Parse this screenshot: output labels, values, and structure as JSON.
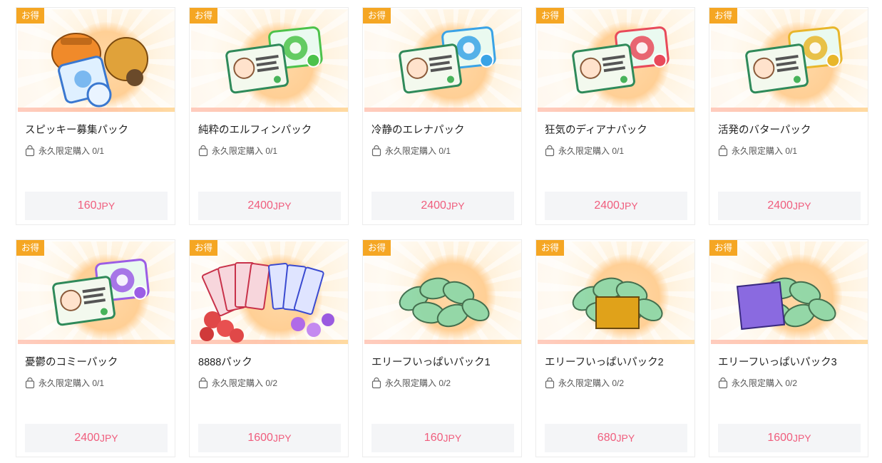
{
  "colors": {
    "badge": "#f5a623",
    "price": "#f05d7d",
    "price_bg": "#f4f5f7"
  },
  "icons": {
    "limit_icon": "shopping-bag-icon"
  },
  "products": [
    {
      "badge": "お得",
      "title": "スピッキー募集パック",
      "limit_label": "永久限定購入",
      "limit_count": "0/1",
      "price": "160",
      "currency": "JPY",
      "art": "bags"
    },
    {
      "badge": "お得",
      "title": "純粋のエルフィンパック",
      "limit_label": "永久限定購入",
      "limit_count": "0/1",
      "price": "2400",
      "currency": "JPY",
      "art": "tickets",
      "accent": "#4cc24a"
    },
    {
      "badge": "お得",
      "title": "冷静のエレナパック",
      "limit_label": "永久限定購入",
      "limit_count": "0/1",
      "price": "2400",
      "currency": "JPY",
      "art": "tickets",
      "accent": "#3aa3e6"
    },
    {
      "badge": "お得",
      "title": "狂気のディアナパック",
      "limit_label": "永久限定購入",
      "limit_count": "0/1",
      "price": "2400",
      "currency": "JPY",
      "art": "tickets",
      "accent": "#e84a5a"
    },
    {
      "badge": "お得",
      "title": "活発のバターパック",
      "limit_label": "永久限定購入",
      "limit_count": "0/1",
      "price": "2400",
      "currency": "JPY",
      "art": "tickets",
      "accent": "#e8b62a"
    },
    {
      "badge": "お得",
      "title": "憂鬱のコミーパック",
      "limit_label": "永久限定購入",
      "limit_count": "0/1",
      "price": "2400",
      "currency": "JPY",
      "art": "tickets",
      "accent": "#9b5de5"
    },
    {
      "badge": "お得",
      "title": "8888パック",
      "limit_label": "永久限定購入",
      "limit_count": "0/2",
      "price": "1600",
      "currency": "JPY",
      "art": "cards"
    },
    {
      "badge": "お得",
      "title": "エリーフいっぱいパック1",
      "limit_label": "永久限定購入",
      "limit_count": "0/2",
      "price": "160",
      "currency": "JPY",
      "art": "leaves"
    },
    {
      "badge": "お得",
      "title": "エリーフいっぱいパック2",
      "limit_label": "永久限定購入",
      "limit_count": "0/2",
      "price": "680",
      "currency": "JPY",
      "art": "box"
    },
    {
      "badge": "お得",
      "title": "エリーフいっぱいパック3",
      "limit_label": "永久限定購入",
      "limit_count": "0/2",
      "price": "1600",
      "currency": "JPY",
      "art": "crate"
    }
  ]
}
